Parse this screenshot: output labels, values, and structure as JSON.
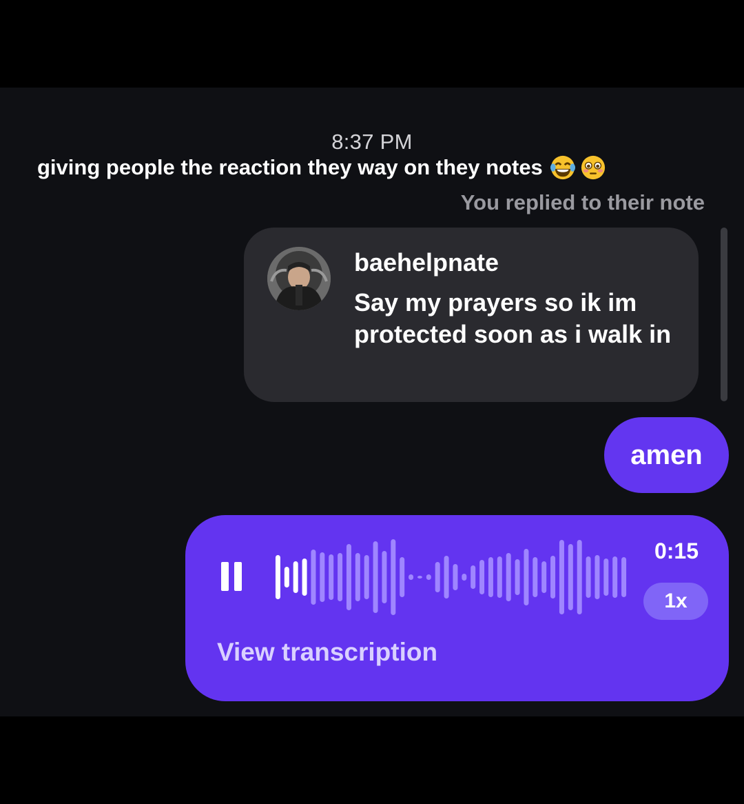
{
  "conversation": {
    "timestamp": "8:37 PM",
    "caption": "giving people the reaction they way on they notes",
    "caption_emojis": [
      "tears-of-joy-emoji",
      "flushed-emoji"
    ],
    "replied_label": "You replied to their note"
  },
  "note": {
    "username": "baehelpnate",
    "text": "Say my prayers so ik im protected soon as i walk in"
  },
  "sent_message": {
    "text": "amen"
  },
  "voice_message": {
    "duration": "0:15",
    "speed": "1x",
    "transcription_label": "View transcription",
    "state_icon": "pause-icon",
    "progress": 0.1
  },
  "colors": {
    "background": "#0f1014",
    "note_bubble": "#2a2a2f",
    "sent_bubble": "#6336f0",
    "voice_bubble": "#6334f0",
    "played_wave": "#ffffff",
    "unplayed_wave": "#9f86ff"
  }
}
